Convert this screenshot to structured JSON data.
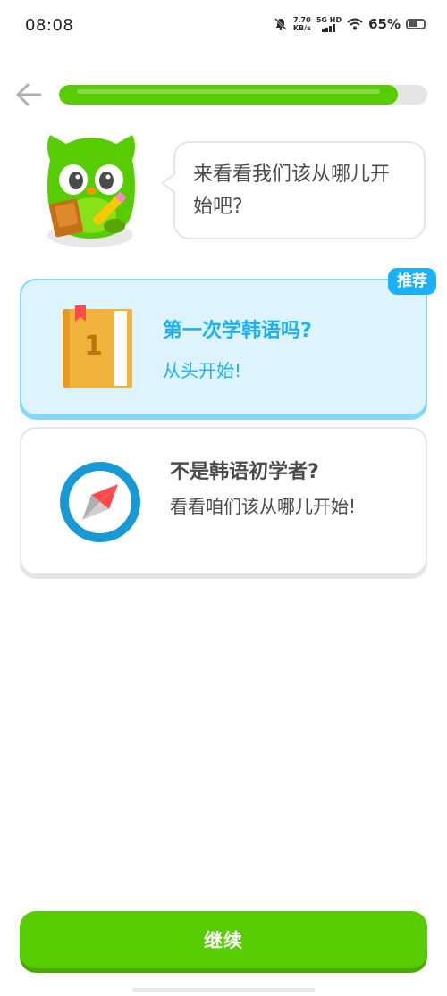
{
  "status_bar": {
    "time": "08:08",
    "speed_value": "7.70",
    "speed_unit": "KB/s",
    "network": "5G HD",
    "battery_percent": "65%",
    "battery_level": 0.65,
    "icons": [
      "bell-muted-icon",
      "signal-icon",
      "wifi-icon",
      "battery-icon"
    ]
  },
  "header": {
    "back_icon": "arrow-left-icon",
    "progress": 0.92,
    "progress_color": "#58cc02"
  },
  "mascot": {
    "speech": "来看看我们该从哪儿开始吧?"
  },
  "options": [
    {
      "badge": "推荐",
      "title": "第一次学韩语吗?",
      "subtitle": "从头开始!",
      "icon": "book-icon",
      "book_number": "1",
      "selected": true,
      "accent": "#1cb0f6"
    },
    {
      "title": "不是韩语初学者?",
      "subtitle": "看看咱们该从哪儿开始!",
      "icon": "compass-icon",
      "selected": false
    }
  ],
  "continue_button": {
    "label": "继续",
    "color": "#58cc02"
  }
}
